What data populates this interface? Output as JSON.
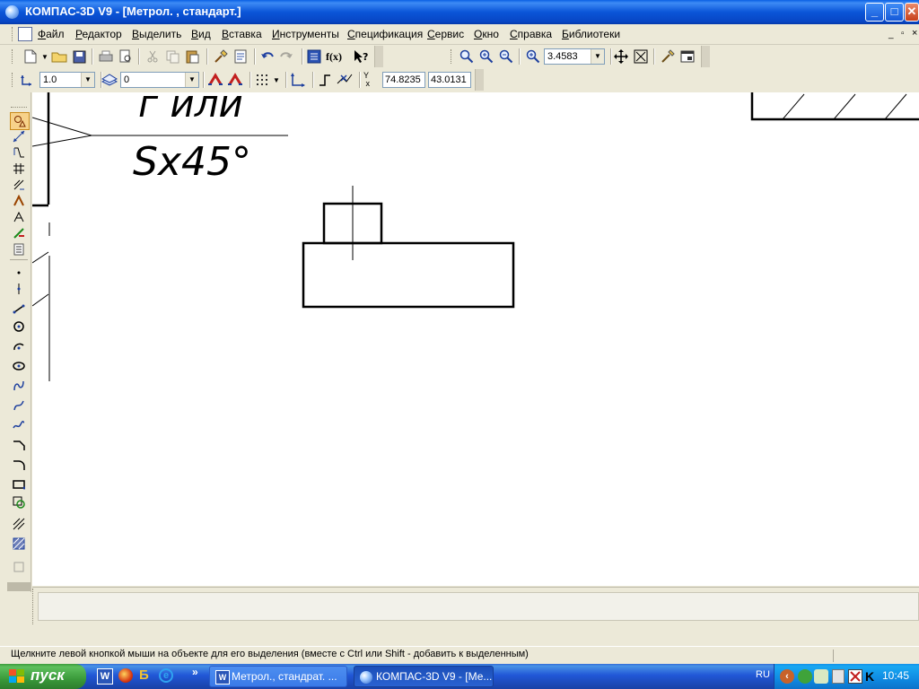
{
  "window": {
    "title": "КОМПАС-3D V9 - [Метрол. , стандарт.]",
    "controls": {
      "minimize": "_",
      "maximize": "□",
      "close": "✕"
    }
  },
  "menu": {
    "items": [
      {
        "label": "Файл"
      },
      {
        "label": "Редактор"
      },
      {
        "label": "Выделить"
      },
      {
        "label": "Вид"
      },
      {
        "label": "Вставка"
      },
      {
        "label": "Инструменты"
      },
      {
        "label": "Спецификация"
      },
      {
        "label": "Сервис"
      },
      {
        "label": "Окно"
      },
      {
        "label": "Справка"
      },
      {
        "label": "Библиотеки"
      }
    ]
  },
  "toolbar": {
    "zoom_value": "3.4583",
    "fx_label": "f(x)"
  },
  "current_state": {
    "step_value": "1.0",
    "layer_value": "0",
    "coord_x": "74.8235",
    "coord_y": "43.0131"
  },
  "drawing": {
    "text_line1": "г или",
    "text_line2": "Sx45°"
  },
  "status": {
    "hint": "Щелкните левой кнопкой мыши на объекте для его выделения (вместе с Ctrl или Shift - добавить к выделенным)"
  },
  "taskbar": {
    "start_label": "пуск",
    "quicklaunch_more": "»",
    "tasks": [
      {
        "label": "Метрол., стандрат. ...",
        "active": false
      },
      {
        "label": "КОМПАС-3D V9 - [Ме...",
        "active": true
      }
    ],
    "language": "RU",
    "clock": "10:45"
  },
  "colors": {
    "titlebar": "#0a55d8",
    "taskbar": "#2157d7",
    "start_button": "#3a9a3a",
    "canvas": "#ffffff",
    "chrome": "#ece9d8"
  }
}
